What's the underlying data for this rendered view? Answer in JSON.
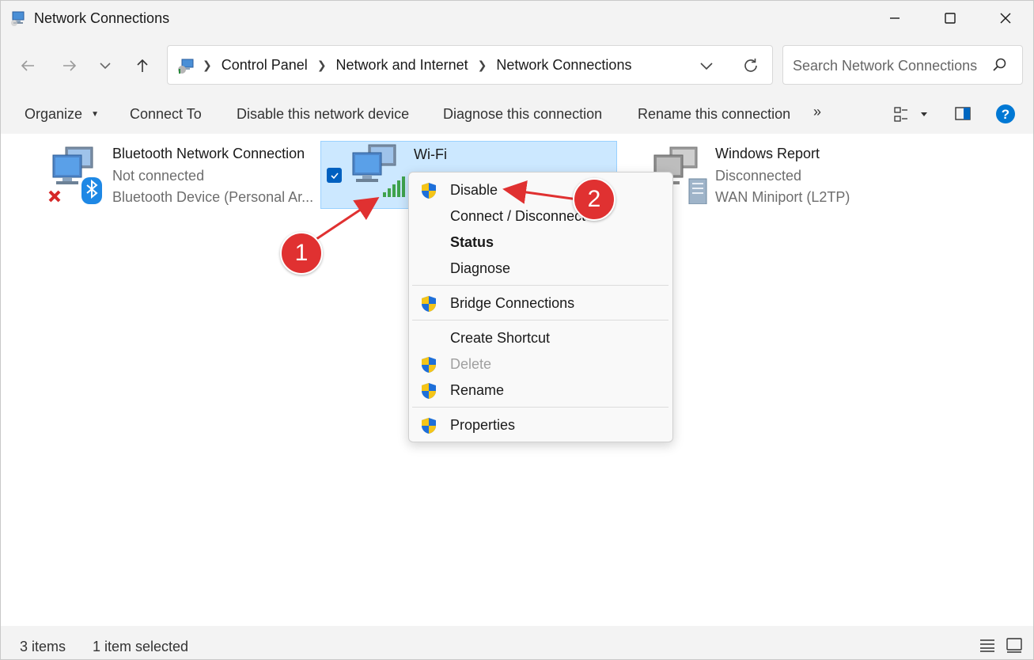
{
  "window": {
    "title": "Network Connections",
    "icon": "network-connections-icon"
  },
  "nav": {
    "back": "back-arrow-icon",
    "forward": "forward-arrow-icon",
    "recent": "chevron-down-icon",
    "up": "up-arrow-icon"
  },
  "breadcrumb": [
    "Control Panel",
    "Network and Internet",
    "Network Connections"
  ],
  "search": {
    "placeholder": "Search Network Connections"
  },
  "commands": {
    "organize": "Organize",
    "connect_to": "Connect To",
    "disable_device": "Disable this network device",
    "diagnose": "Diagnose this connection",
    "rename": "Rename this connection",
    "more": "»"
  },
  "connections": [
    {
      "name": "Bluetooth Network Connection",
      "status": "Not connected",
      "device": "Bluetooth Device (Personal Ar...",
      "selected": false
    },
    {
      "name": "Wi-Fi",
      "status": "",
      "device": "",
      "selected": true
    },
    {
      "name": "Windows Report",
      "status": "Disconnected",
      "device": "WAN Miniport (L2TP)",
      "selected": false
    }
  ],
  "context_menu": {
    "items": [
      {
        "label": "Disable",
        "shield": true,
        "bold": false,
        "disabled": false
      },
      {
        "label": "Connect / Disconnect",
        "shield": false,
        "bold": false,
        "disabled": false
      },
      {
        "label": "Status",
        "shield": false,
        "bold": true,
        "disabled": false
      },
      {
        "label": "Diagnose",
        "shield": false,
        "bold": false,
        "disabled": false
      },
      {
        "label": "Bridge Connections",
        "shield": true,
        "bold": false,
        "disabled": false
      },
      {
        "label": "Create Shortcut",
        "shield": false,
        "bold": false,
        "disabled": false
      },
      {
        "label": "Delete",
        "shield": true,
        "bold": false,
        "disabled": true
      },
      {
        "label": "Rename",
        "shield": true,
        "bold": false,
        "disabled": false
      },
      {
        "label": "Properties",
        "shield": true,
        "bold": false,
        "disabled": false
      }
    ]
  },
  "status_bar": {
    "count": "3 items",
    "selected": "1 item selected"
  },
  "annotations": {
    "step1": "1",
    "step2": "2"
  },
  "colors": {
    "accent": "#0067c0",
    "selection": "#cce8ff",
    "annotation": "#e03131",
    "help": "#0078d4"
  }
}
